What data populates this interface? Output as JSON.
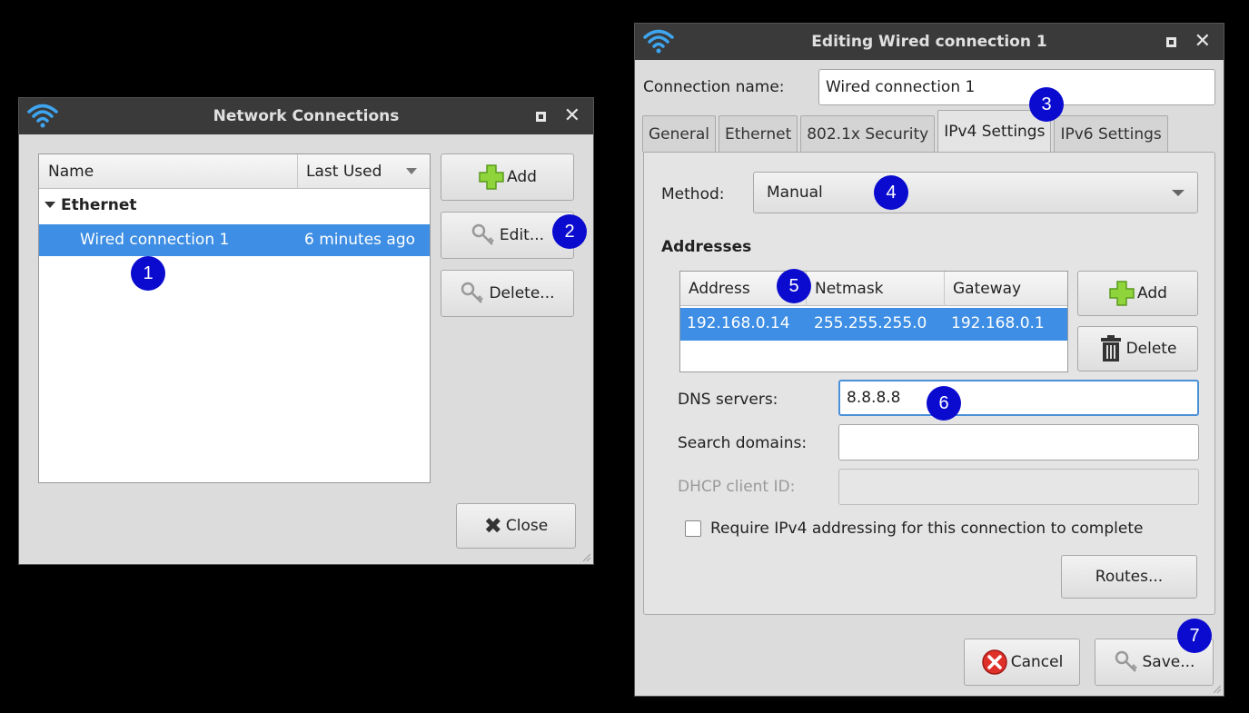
{
  "network_connections": {
    "title": "Network Connections",
    "columns": {
      "name": "Name",
      "last_used": "Last Used"
    },
    "group": "Ethernet",
    "rows": [
      {
        "name": "Wired connection 1",
        "last_used": "6 minutes ago"
      }
    ],
    "buttons": {
      "add": "Add",
      "edit": "Edit...",
      "delete": "Delete...",
      "close": "Close"
    }
  },
  "editor": {
    "title": "Editing Wired connection 1",
    "connection_name_label": "Connection name:",
    "connection_name_value": "Wired connection 1",
    "tabs": [
      "General",
      "Ethernet",
      "802.1x Security",
      "IPv4 Settings",
      "IPv6 Settings"
    ],
    "active_tab": "IPv4 Settings",
    "method_label": "Method:",
    "method_value": "Manual",
    "addresses_heading": "Addresses",
    "address_columns": {
      "address": "Address",
      "netmask": "Netmask",
      "gateway": "Gateway"
    },
    "address_rows": [
      {
        "address": "192.168.0.14",
        "netmask": "255.255.255.0",
        "gateway": "192.168.0.1"
      }
    ],
    "address_buttons": {
      "add": "Add",
      "delete": "Delete"
    },
    "dns_label": "DNS servers:",
    "dns_value": "8.8.8.8",
    "search_domains_label": "Search domains:",
    "search_domains_value": "",
    "dhcp_label": "DHCP client ID:",
    "dhcp_value": "",
    "require_ipv4_label": "Require IPv4 addressing for this connection to complete",
    "require_ipv4_checked": false,
    "routes_button": "Routes...",
    "cancel_button": "Cancel",
    "save_button": "Save..."
  },
  "markers": [
    "1",
    "2",
    "3",
    "4",
    "5",
    "6",
    "7"
  ],
  "colors": {
    "selection": "#3d8ee4",
    "marker": "#0b0bd0",
    "titlebar": "#3a3a3a",
    "focus": "#4a90d9"
  },
  "icons": [
    "wifi-icon",
    "maximize-icon",
    "close-icon",
    "plus-icon",
    "keys-icon",
    "x-icon",
    "trash-icon",
    "cancel-icon",
    "dropdown-arrow-icon"
  ]
}
